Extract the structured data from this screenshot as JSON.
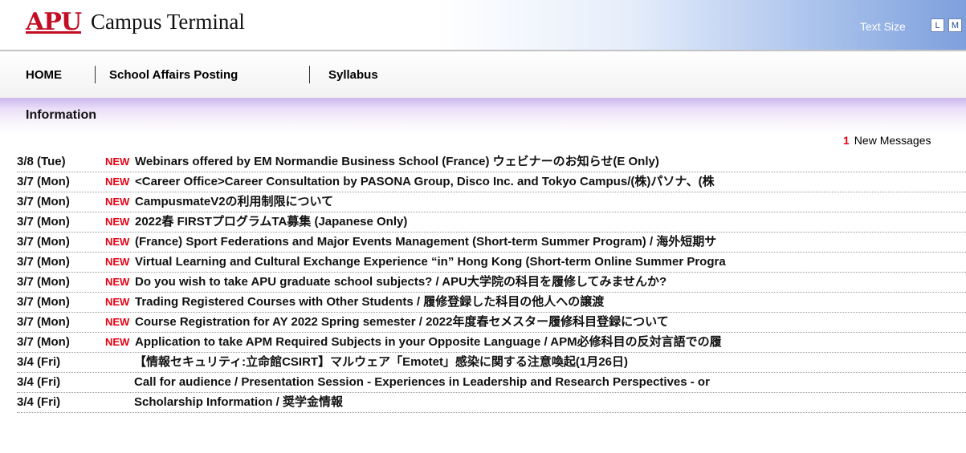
{
  "header": {
    "logo_text": "APU",
    "title": "Campus Terminal",
    "text_size_label": "Text Size",
    "size_buttons": [
      "L",
      "M"
    ]
  },
  "nav": {
    "items": [
      "HOME",
      "School Affairs Posting",
      "Syllabus"
    ]
  },
  "info": {
    "title": "Information",
    "new_count": "1",
    "new_label": "New Messages"
  },
  "messages": [
    {
      "date": "3/8 (Tue)",
      "badge": "NEW",
      "title": "Webinars offered by EM Normandie Business School (France) ウェビナーのお知らせ(E Only)"
    },
    {
      "date": "3/7 (Mon)",
      "badge": "NEW",
      "title": "<Career Office>Career Consultation by PASONA Group, Disco Inc. and Tokyo Campus/(株)パソナ、(株"
    },
    {
      "date": "3/7 (Mon)",
      "badge": "NEW",
      "title": "CampusmateV2の利用制限について"
    },
    {
      "date": "3/7 (Mon)",
      "badge": "NEW",
      "title": "2022春 FIRSTプログラムTA募集 (Japanese Only)"
    },
    {
      "date": "3/7 (Mon)",
      "badge": "NEW",
      "title": "(France) Sport Federations and Major Events Management (Short-term Summer Program) / 海外短期サ"
    },
    {
      "date": "3/7 (Mon)",
      "badge": "NEW",
      "title": "Virtual Learning and Cultural Exchange Experience “in” Hong Kong (Short-term Online Summer Progra"
    },
    {
      "date": "3/7 (Mon)",
      "badge": "NEW",
      "title": "Do you wish to take APU graduate school subjects? / APU大学院の科目を履修してみませんか?"
    },
    {
      "date": "3/7 (Mon)",
      "badge": "NEW",
      "title": "Trading Registered Courses with Other Students / 履修登録した科目の他人への譲渡"
    },
    {
      "date": "3/7 (Mon)",
      "badge": "NEW",
      "title": "Course Registration for AY 2022 Spring semester / 2022年度春セメスター履修科目登録について"
    },
    {
      "date": "3/7 (Mon)",
      "badge": "NEW",
      "title": "Application to take APM Required Subjects in your Opposite Language / APM必修科目の反対言語での履"
    },
    {
      "date": "3/4 (Fri)",
      "badge": "",
      "title": "【情報セキュリティ:立命館CSIRT】マルウェア「Emotet」感染に関する注意喚起(1月26日)"
    },
    {
      "date": "3/4 (Fri)",
      "badge": "",
      "title": "Call for audience / Presentation Session - Experiences in Leadership and Research Perspectives - or"
    },
    {
      "date": "3/4 (Fri)",
      "badge": "",
      "title": "Scholarship Information / 奨学金情報"
    }
  ]
}
